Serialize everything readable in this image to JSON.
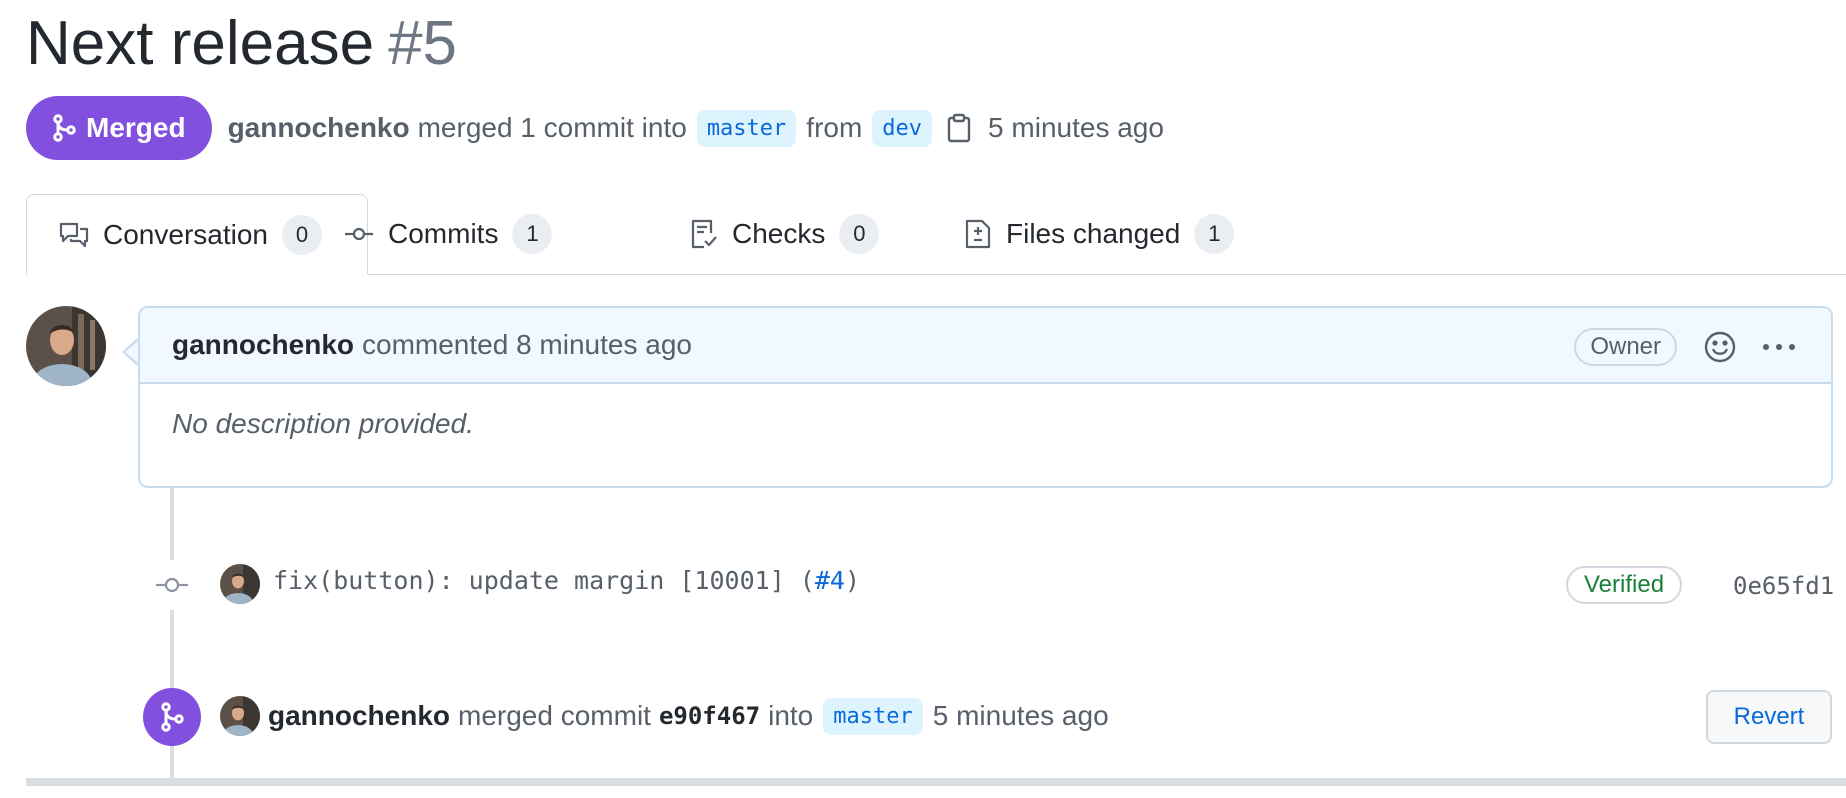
{
  "pr": {
    "title": "Next release",
    "number": "#5"
  },
  "header": {
    "state_label": "Merged",
    "author": "gannochenko",
    "merged_text": "merged 1 commit into",
    "base_branch": "master",
    "from_text": "from",
    "head_branch": "dev",
    "time": "5 minutes ago"
  },
  "tabs": [
    {
      "label": "Conversation",
      "count": "0",
      "icon": "comment-discussion-icon"
    },
    {
      "label": "Commits",
      "count": "1",
      "icon": "git-commit-icon"
    },
    {
      "label": "Checks",
      "count": "0",
      "icon": "checklist-icon"
    },
    {
      "label": "Files changed",
      "count": "1",
      "icon": "file-diff-icon"
    }
  ],
  "comment": {
    "author": "gannochenko",
    "action": "commented 8 minutes ago",
    "role_badge": "Owner",
    "body": "No description provided."
  },
  "commit": {
    "message": "fix(button): update margin [10001] (",
    "issue": "#4",
    "message_end": ")",
    "verified": "Verified",
    "sha": "0e65fd1"
  },
  "merge_event": {
    "author": "gannochenko",
    "text1": "merged commit",
    "sha": "e90f467",
    "text2": "into",
    "branch": "master",
    "time": "5 minutes ago",
    "revert_label": "Revert"
  },
  "colors": {
    "merged_purple": "#8250df",
    "link_blue": "#0969da",
    "verified_green": "#1a7f37"
  }
}
